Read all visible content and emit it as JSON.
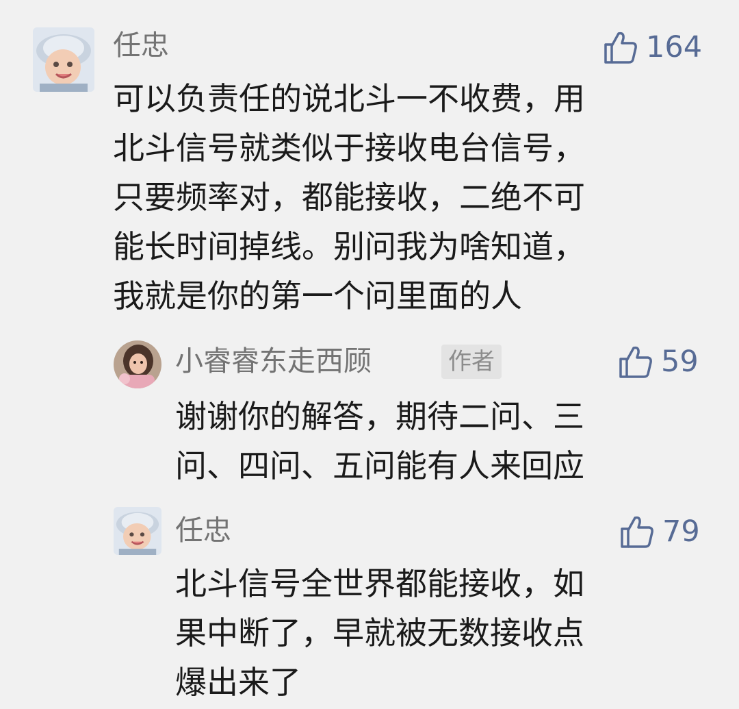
{
  "comments": [
    {
      "author": "任忠",
      "likes": "164",
      "lines": [
        "可以负责任的说北斗一不收费，用",
        "北斗信号就类似于接收电台信号，",
        "只要频率对，都能接收，二绝不可",
        "能长时间掉线。别问我为啥知道，",
        "我就是你的第一个问里面的人"
      ],
      "avatar": "baby-avatar"
    },
    {
      "author": "小睿睿东走西顾",
      "badge": "作者",
      "likes": "59",
      "lines": [
        "谢谢你的解答，期待二问、三",
        "问、四问、五问能有人来回应"
      ],
      "avatar": "girl-avatar"
    },
    {
      "author": "任忠",
      "likes": "79",
      "lines": [
        "北斗信号全世界都能接收，如",
        "果中断了，早就被无数接收点",
        "爆出来了"
      ],
      "avatar": "baby-avatar"
    }
  ],
  "colors": {
    "accent": "#576b95",
    "nickname": "#737373",
    "text": "#1a1a1a",
    "background": "#f1f1f1"
  }
}
